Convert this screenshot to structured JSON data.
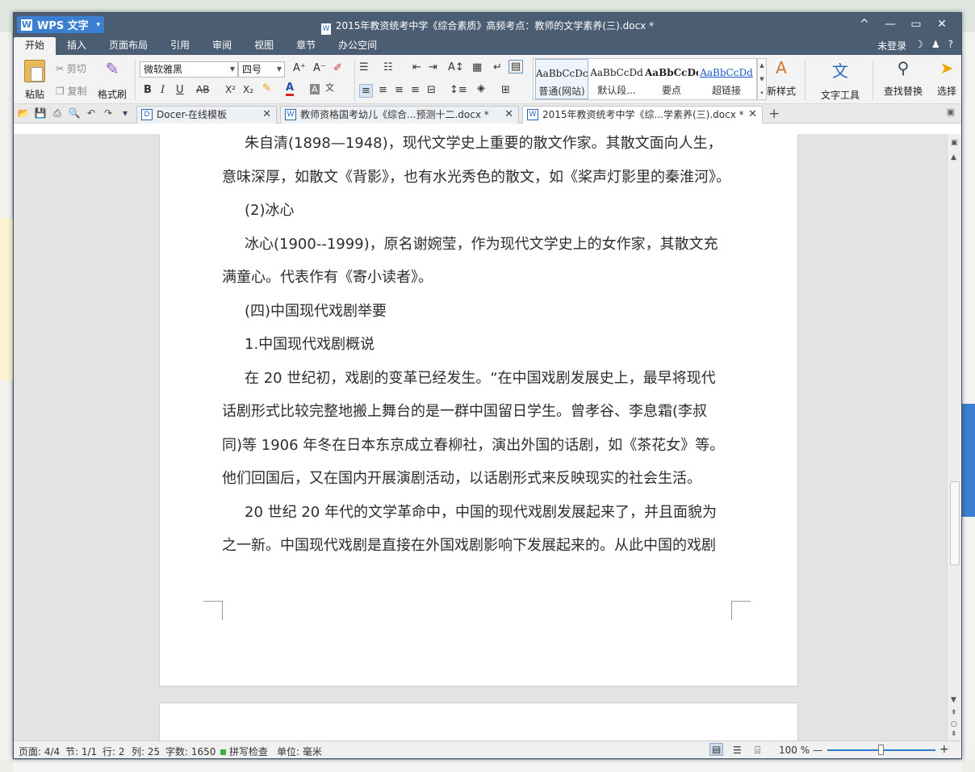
{
  "window": {
    "app_button": "WPS 文字",
    "title": "2015年教资统考中学《综合素质》高频考点：教师的文学素养(三).docx *",
    "controls": [
      "^",
      "—",
      "▭",
      "✕"
    ]
  },
  "menu": {
    "tabs": [
      "开始",
      "插入",
      "页面布局",
      "引用",
      "审阅",
      "视图",
      "章节",
      "办公空间"
    ],
    "active_tab": "开始",
    "login": "未登录",
    "help": "?"
  },
  "ribbon": {
    "paste": "粘贴",
    "cut": "剪切",
    "copy": "复制",
    "format_painter": "格式刷",
    "font_name": "微软雅黑",
    "font_size": "四号",
    "bold": "B",
    "italic": "I",
    "underline": "U",
    "strike": "AB",
    "superscript": "X²",
    "subscript": "X₂",
    "styles": [
      {
        "preview": "AaBbCcDc",
        "name": "普通(网站)"
      },
      {
        "preview": "AaBbCcDd",
        "name": "默认段..."
      },
      {
        "preview": "AaBbCcDc",
        "name": "要点"
      },
      {
        "preview": "AaBbCcDd",
        "name": "超链接"
      }
    ],
    "new_style": "新样式",
    "text_tools": "文字工具",
    "find_replace": "查找替换",
    "select": "选择"
  },
  "doc_tabs": [
    {
      "label": "Docer-在线模板",
      "active": false
    },
    {
      "label": "教师资格国考幼儿《综合...预测十二.docx *",
      "active": false
    },
    {
      "label": "2015年教资统考中学《综...学素养(三).docx *",
      "active": true
    }
  ],
  "document": {
    "paragraphs": [
      {
        "text": "朱自清(1898—1948)，现代文学史上重要的散文作家。其散文面向人生，",
        "indent": true
      },
      {
        "text": "意味深厚，如散文《背影》，也有水光秀色的散文，如《桨声灯影里的秦淮河》。",
        "indent": false
      },
      {
        "text": "(2)冰心",
        "indent": true
      },
      {
        "text": "冰心(1900--1999)，原名谢婉莹，作为现代文学史上的女作家，其散文充",
        "indent": true
      },
      {
        "text": "满童心。代表作有《寄小读者》。",
        "indent": false
      },
      {
        "text": "(四)中国现代戏剧举要",
        "indent": true
      },
      {
        "text": "1.中国现代戏剧概说",
        "indent": true
      },
      {
        "text": "在 20 世纪初，戏剧的变革已经发生。“在中国戏剧发展史上，最早将现代",
        "indent": true
      },
      {
        "text": "话剧形式比较完整地搬上舞台的是一群中国留日学生。曾孝谷、李息霜(李叔",
        "indent": false
      },
      {
        "text": "同)等 1906 年冬在日本东京成立春柳社，演出外国的话剧，如《茶花女》等。",
        "indent": false
      },
      {
        "text": "他们回国后，又在国内开展演剧活动，以话剧形式来反映现实的社会生活。",
        "indent": false
      },
      {
        "text": "20 世纪 20 年代的文学革命中，中国的现代戏剧发展起来了，并且面貌为",
        "indent": true
      },
      {
        "text": "之一新。中国现代戏剧是直接在外国戏剧影响下发展起来的。从此中国的戏剧",
        "indent": false
      }
    ]
  },
  "status": {
    "page": "页面: 4/4",
    "section": "节: 1/1",
    "row": "行: 2",
    "col": "列: 25",
    "words": "字数: 1650",
    "spell": "拼写检查",
    "unit": "单位: 毫米",
    "zoom": "100 %"
  }
}
